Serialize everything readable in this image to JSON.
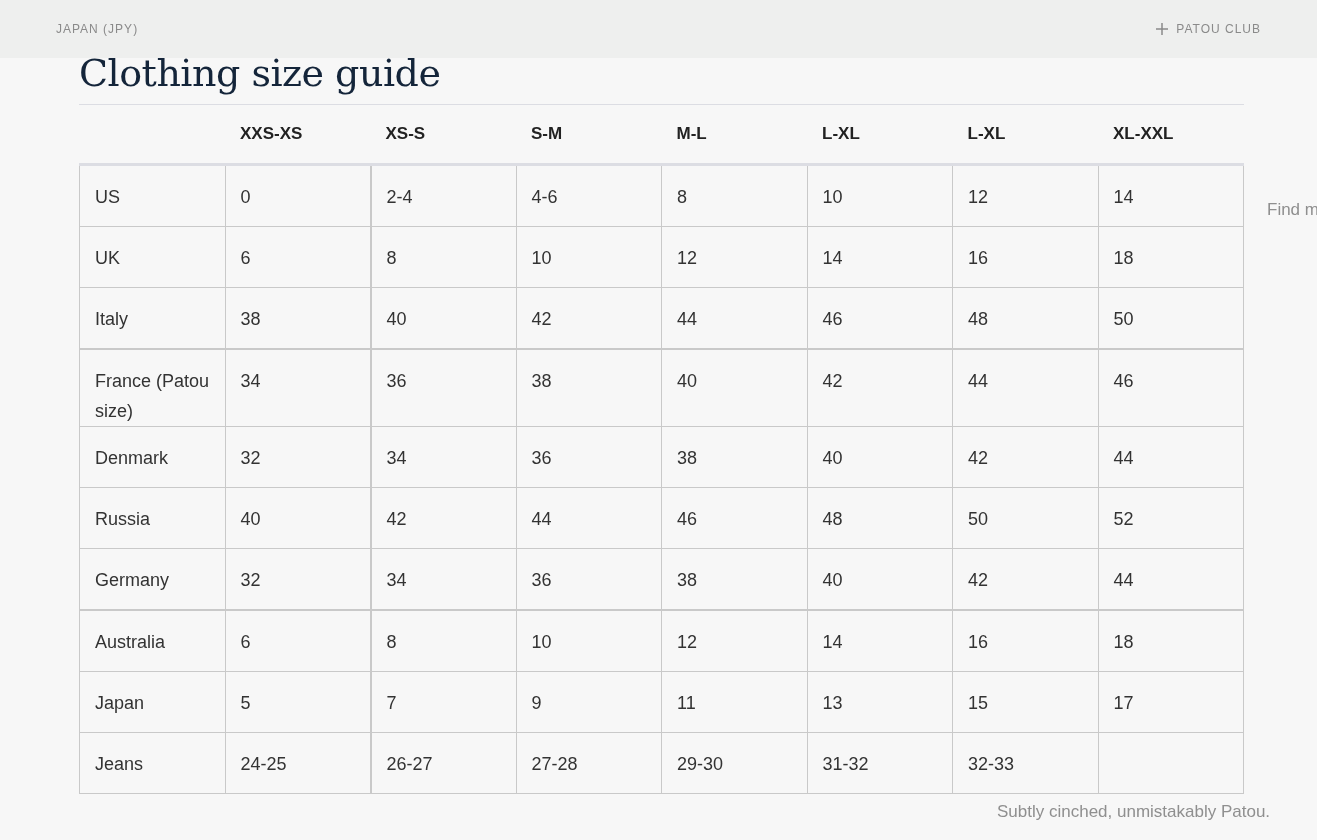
{
  "top_bar": {
    "currency": "JAPAN (JPY)",
    "club": "PATOU CLUB"
  },
  "background": {
    "size_link": "Find m",
    "tagline": "Subtly cinched, unmistakably Patou."
  },
  "size_guide": {
    "title": "Clothing size guide",
    "columns": [
      "XXS-XS",
      "XS-S",
      "S-M",
      "M-L",
      "L-XL",
      "L-XL",
      "XL-XXL"
    ],
    "rows": [
      {
        "label": "US",
        "values": [
          "0",
          "2-4",
          "4-6",
          "8",
          "10",
          "12",
          "14"
        ]
      },
      {
        "label": "UK",
        "values": [
          "6",
          "8",
          "10",
          "12",
          "14",
          "16",
          "18"
        ]
      },
      {
        "label": "Italy",
        "values": [
          "38",
          "40",
          "42",
          "44",
          "46",
          "48",
          "50"
        ]
      },
      {
        "label": "France (Patou size)",
        "values": [
          "34",
          "36",
          "38",
          "40",
          "42",
          "44",
          "46"
        ]
      },
      {
        "label": "Denmark",
        "values": [
          "32",
          "34",
          "36",
          "38",
          "40",
          "42",
          "44"
        ]
      },
      {
        "label": "Russia",
        "values": [
          "40",
          "42",
          "44",
          "46",
          "48",
          "50",
          "52"
        ]
      },
      {
        "label": "Germany",
        "values": [
          "32",
          "34",
          "36",
          "38",
          "40",
          "42",
          "44"
        ]
      },
      {
        "label": "Australia",
        "values": [
          "6",
          "8",
          "10",
          "12",
          "14",
          "16",
          "18"
        ]
      },
      {
        "label": "Japan",
        "values": [
          "5",
          "7",
          "9",
          "11",
          "13",
          "15",
          "17"
        ]
      },
      {
        "label": "Jeans",
        "values": [
          "24-25",
          "26-27",
          "27-28",
          "29-30",
          "31-32",
          "32-33"
        ]
      }
    ]
  }
}
